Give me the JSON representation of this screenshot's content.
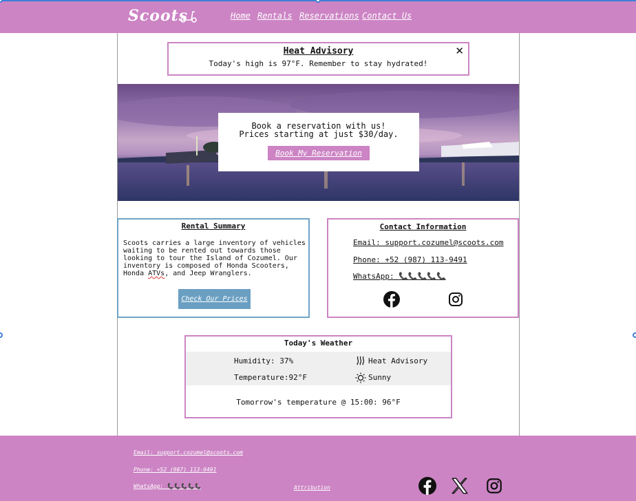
{
  "header": {
    "logo": "Scoots",
    "nav": [
      "Home",
      "Rentals",
      "Reservations",
      "Contact Us"
    ]
  },
  "advisory": {
    "title": "Heat Advisory",
    "text": "Today's high is 97°F. Remember to stay hydrated!",
    "close": "✕"
  },
  "hero": {
    "line1": "Book a reservation with us!",
    "line2": "Prices starting at just $30/day.",
    "button": "Book My Reservation"
  },
  "rental": {
    "title": "Rental Summary",
    "text_before": "Scoots carries a large inventory of vehicles waiting to be rented out towards those looking to tour the Island of Cozumel. Our inventory is composed of Honda Scooters, Honda ",
    "text_atvs": "ATVs",
    "text_after": ", and Jeep Wranglers.",
    "button": "Check Our Prices"
  },
  "contact": {
    "title": "Contact Information",
    "email": "Email: support.cozumel@scoots.com",
    "phone": "Phone: +52 (987) 113-9491",
    "whatsapp_label": "WhatsApp:",
    "whatsapp_icons": "📞📞📞📞📞",
    "socials": [
      "facebook-icon",
      "instagram-icon"
    ]
  },
  "weather": {
    "title": "Today's Weather",
    "humidity": "Humidity: 37%",
    "advisory": "Heat Advisory",
    "temperature": "Temperature:92°F",
    "condition": "Sunny",
    "tomorrow": "Tomorrow's temperature @ 15:00: 96°F"
  },
  "footer": {
    "email": "Email: support.cozumel@scoots.com",
    "phone": "Phone: +52 (987) 113-9491",
    "whatsapp_label": "WhatsApp:",
    "whatsapp_icons": "📞📞📞📞📞",
    "attribution": "Attribution",
    "socials": [
      "facebook-icon",
      "x-icon",
      "instagram-icon"
    ]
  },
  "colors": {
    "brand_pink": "#cc84c4",
    "accent_blue": "#6a9fc2"
  }
}
